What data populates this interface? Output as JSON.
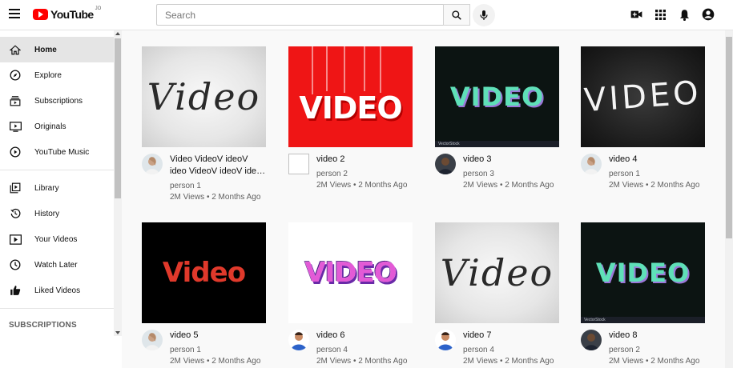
{
  "header": {
    "logo_text": "YouTube",
    "logo_region": "JO",
    "search_placeholder": "Search",
    "icons": [
      "create-video-icon",
      "apps-icon",
      "notifications-icon",
      "account-icon"
    ]
  },
  "sidebar": {
    "items": [
      {
        "label": "Home",
        "icon": "home-icon",
        "active": true
      },
      {
        "label": "Explore",
        "icon": "explore-icon"
      },
      {
        "label": "Subscriptions",
        "icon": "subscriptions-icon"
      },
      {
        "label": "Originals",
        "icon": "originals-icon"
      },
      {
        "label": "YouTube Music",
        "icon": "music-icon"
      },
      {
        "label": "Library",
        "icon": "library-icon"
      },
      {
        "label": "History",
        "icon": "history-icon"
      },
      {
        "label": "Your Videos",
        "icon": "your-videos-icon"
      },
      {
        "label": "Watch Later",
        "icon": "watch-later-icon"
      },
      {
        "label": "Liked Videos",
        "icon": "liked-videos-icon"
      }
    ],
    "subscriptions_heading": "SUBSCRIPTIONS"
  },
  "videos": [
    {
      "title": "Video VideoV ideoV ideo VideoV ideoV ideo VideoV ideoV ideo",
      "channel": "person 1",
      "stats": "2M Views • 2 Months Ago",
      "thumb_text": "Video"
    },
    {
      "title": "video 2",
      "channel": "person 2",
      "stats": "2M Views • 2 Months Ago",
      "thumb_text": "VIDEO"
    },
    {
      "title": "video 3",
      "channel": "person 3",
      "stats": "2M Views • 2 Months Ago",
      "thumb_text": "VIDEO",
      "watermark": "VectorStock"
    },
    {
      "title": "video 4",
      "channel": "person 1",
      "stats": "2M Views • 2 Months Ago",
      "thumb_text": "VIDEO"
    },
    {
      "title": "video 5",
      "channel": "person 1",
      "stats": "2M Views • 2 Months Ago",
      "thumb_text": "Video"
    },
    {
      "title": "video 6",
      "channel": "person 4",
      "stats": "2M Views • 2 Months Ago",
      "thumb_text": "VIDEO"
    },
    {
      "title": "video 7",
      "channel": "person 4",
      "stats": "2M Views • 2 Months Ago",
      "thumb_text": "Video"
    },
    {
      "title": "video 8",
      "channel": "person 2",
      "stats": "2M Views • 2 Months Ago",
      "thumb_text": "VIDEO",
      "watermark": "VectorStock"
    }
  ]
}
